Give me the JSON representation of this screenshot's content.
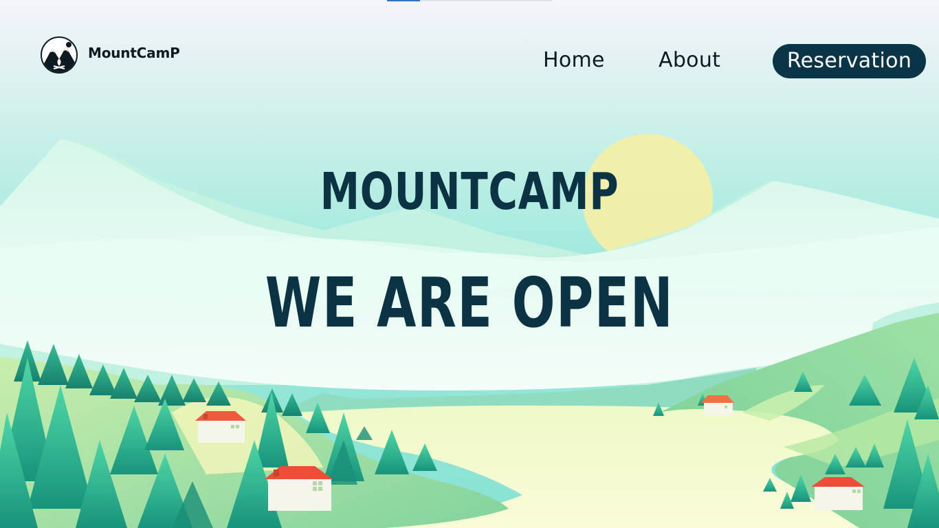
{
  "brand": {
    "name": "MountCamP"
  },
  "nav": {
    "home": "Home",
    "about": "About",
    "reservation": "Reservation"
  },
  "hero": {
    "title": "MOUNTCAMP",
    "subtitle": "WE ARE OPEN"
  },
  "colors": {
    "primary_dark": "#0a3547",
    "sky_top": "#f3f4fb",
    "sky_bottom": "#8fe6d6",
    "sun": "#f2efa8",
    "tree_green": "#2fbf94",
    "roof_red": "#ee4e37"
  },
  "icons": {
    "logo": "mountain-campfire-icon"
  }
}
